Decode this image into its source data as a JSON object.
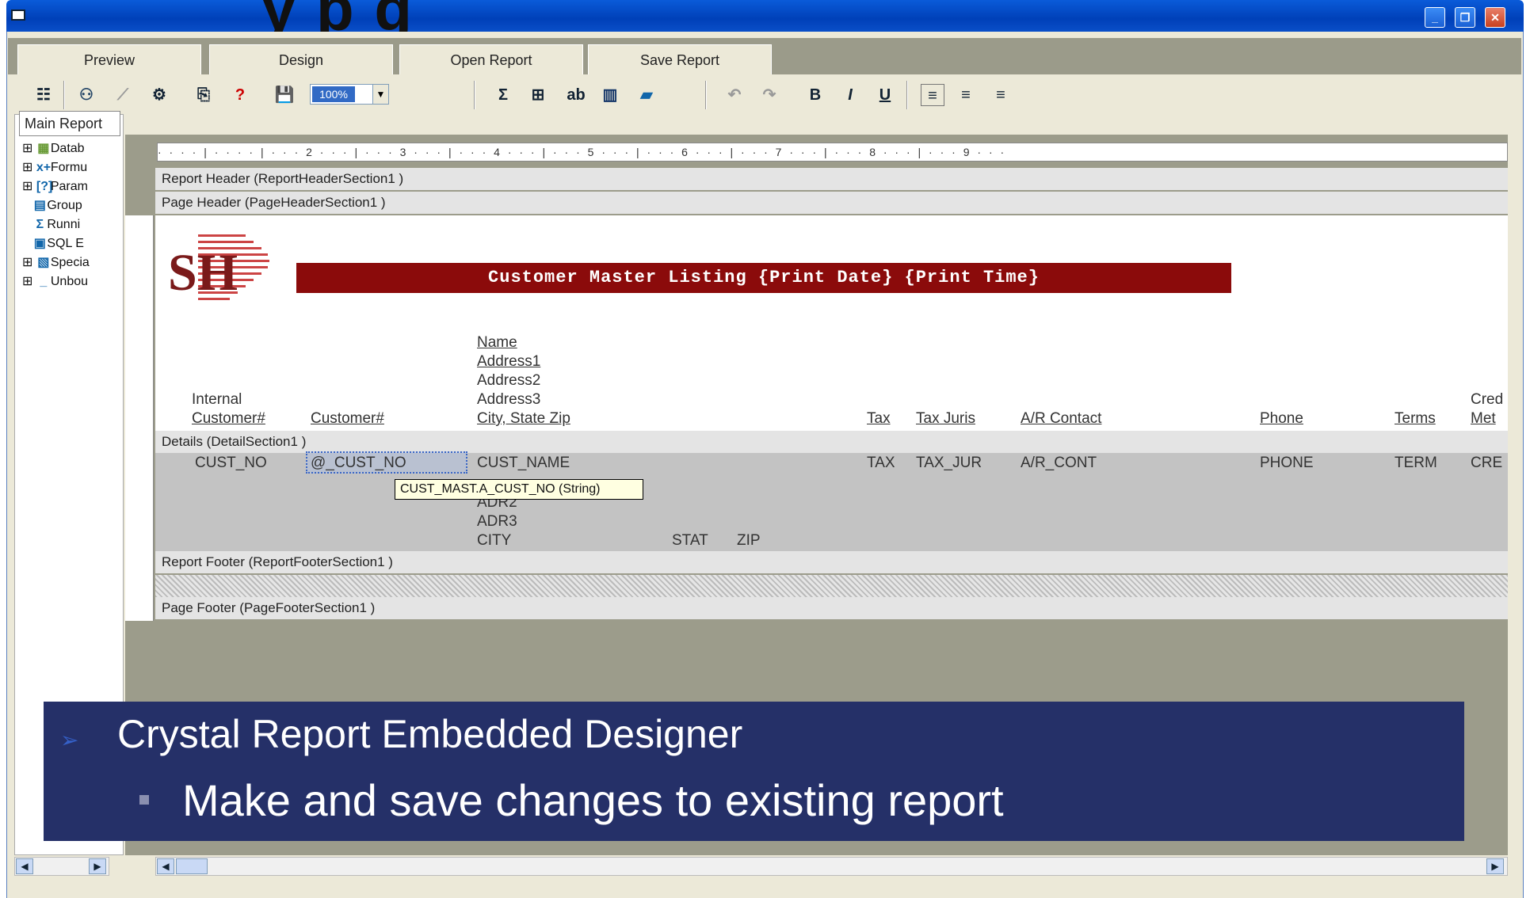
{
  "window": {
    "title_overlay": "y     p     g",
    "controls": [
      "minimize",
      "restore",
      "close"
    ]
  },
  "tabs": [
    {
      "label": "Preview"
    },
    {
      "label": "Design"
    },
    {
      "label": "Open Report"
    },
    {
      "label": "Save Report"
    }
  ],
  "toolbar": {
    "zoom": "100%",
    "icons": [
      "tree-icon",
      "explorer-icon",
      "magic-wand-icon",
      "tools-icon",
      "find-icon",
      "help-icon",
      "save-icon",
      "sum-icon",
      "group-icon",
      "text-icon",
      "chart-icon",
      "map-icon",
      "undo-icon",
      "redo-icon",
      "bold-icon",
      "italic-icon",
      "underline-icon",
      "align-left-icon",
      "align-center-icon",
      "align-right-icon"
    ],
    "bold": "B",
    "italic": "I",
    "underline": "U",
    "sum": "Σ",
    "help": "?"
  },
  "sidebar": {
    "tab_label": "Main Report",
    "items": [
      {
        "label": "Datab",
        "icon": "database-icon"
      },
      {
        "label": "Formu",
        "icon": "formula-icon"
      },
      {
        "label": "Param",
        "icon": "parameter-icon"
      },
      {
        "label": "Group",
        "icon": "group-icon"
      },
      {
        "label": "Runni",
        "icon": "running-total-icon"
      },
      {
        "label": "SQL E",
        "icon": "sql-icon"
      },
      {
        "label": "Specia",
        "icon": "special-field-icon"
      },
      {
        "label": "Unbou",
        "icon": "unbound-icon"
      }
    ]
  },
  "ruler": {
    "text": "· · · · | · · · · | · · · 2 · · · | · · · 3 · · · | · · · 4 · · · | · · · 5 · · · | · · · 6 · · · | · · · 7 · · · | · · · 8 · · · | · · · 9 · · ·"
  },
  "sections": {
    "report_header": "Report Header (ReportHeaderSection1 )",
    "page_header": "Page Header (PageHeaderSection1 )",
    "details": "Details (DetailSection1 )",
    "report_footer": "Report Footer (ReportFooterSection1 )",
    "page_footer": "Page Footer (PageFooterSection1 )"
  },
  "logo_text": "SH",
  "banner_title": "Customer Master Listing  {Print Date} {Print Time}",
  "page_header_fields": {
    "internal": "Internal",
    "customer_num1": "Customer#",
    "customer_num2": "Customer#",
    "name": "Name",
    "address1": "Address1",
    "address2": "Address2",
    "address3": "Address3",
    "city_state_zip": "City, State Zip",
    "tax": "Tax",
    "tax_juris": "Tax Juris",
    "ar_contact": "A/R Contact",
    "phone": "Phone",
    "terms": "Terms",
    "cred": "Cred",
    "met": "Met"
  },
  "detail_fields": {
    "cust_no": "CUST_NO",
    "cust_no2": "@_CUST_NO",
    "cust_name": "CUST_NAME",
    "adr2": "ADR2",
    "adr3": "ADR3",
    "city": "CITY",
    "stat": "STAT",
    "zip": "ZIP",
    "tax": "TAX",
    "tax_jur": "TAX_JUR",
    "ar_cont": "A/R_CONT",
    "phone": "PHONE",
    "terms": "TERM",
    "cred": "CRE"
  },
  "tooltip": "CUST_MAST.A_CUST_NO (String)",
  "overlay": {
    "line1": "Crystal Report Embedded Designer",
    "line2": "Make and save changes to existing report"
  },
  "colors": {
    "titlebar": "#0a4fc8",
    "banner": "#8b0b0b",
    "overlay": "#253068"
  }
}
